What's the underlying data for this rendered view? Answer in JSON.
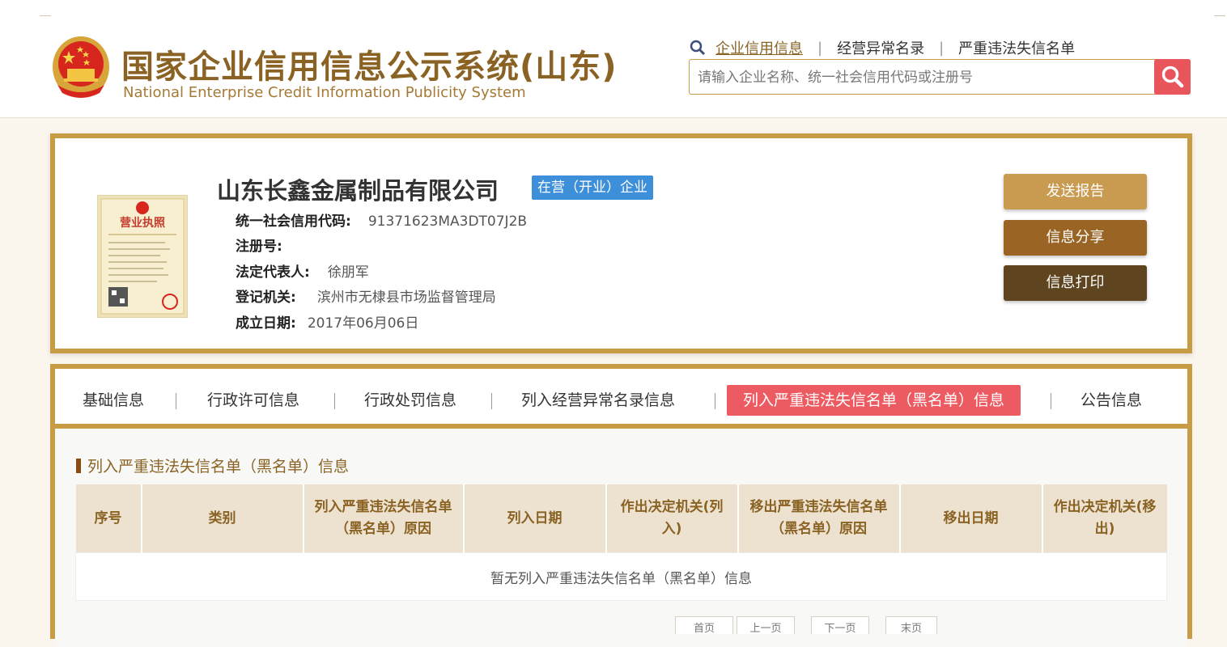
{
  "header": {
    "title": "国家企业信用信息公示系统(山东)",
    "subtitle": "National Enterprise Credit Information Publicity System",
    "nav": [
      {
        "label": "企业信用信息",
        "active": true
      },
      {
        "label": "经营异常名录",
        "active": false
      },
      {
        "label": "严重违法失信名单",
        "active": false
      }
    ],
    "search": {
      "placeholder": "请输入企业名称、统一社会信用代码或注册号",
      "value": ""
    }
  },
  "company": {
    "name": "山东长鑫金属制品有限公司",
    "status": "在营（开业）企业",
    "license_image_title": "营业执照",
    "fields": [
      {
        "label": "统一社会信用代码:",
        "value": "91371623MA3DT07J2B"
      },
      {
        "label": "注册号:",
        "value": ""
      },
      {
        "label": "法定代表人:",
        "value": "徐朋军"
      },
      {
        "label": "登记机关:",
        "value": "滨州市无棣县市场监督管理局"
      },
      {
        "label": "成立日期:",
        "value": "2017年06月06日"
      }
    ],
    "actions": [
      {
        "label": "发送报告",
        "color": "#c89b50"
      },
      {
        "label": "信息分享",
        "color": "#9a6524"
      },
      {
        "label": "信息打印",
        "color": "#5e4520"
      }
    ]
  },
  "tabs": [
    {
      "label": "基础信息",
      "active": false
    },
    {
      "label": "行政许可信息",
      "active": false
    },
    {
      "label": "行政处罚信息",
      "active": false
    },
    {
      "label": "列入经营异常名录信息",
      "active": false
    },
    {
      "label": "列入严重违法失信名单（黑名单）信息",
      "active": true
    },
    {
      "label": "公告信息",
      "active": false
    }
  ],
  "section": {
    "title": "列入严重违法失信名单（黑名单）信息",
    "columns": [
      "序号",
      "类别",
      "列入严重违法失信名单（黑名单）原因",
      "列入日期",
      "作出决定机关(列入)",
      "移出严重违法失信名单（黑名单）原因",
      "移出日期",
      "作出决定机关(移出)"
    ],
    "empty_message": "暂无列入严重违法失信名单（黑名单）信息"
  },
  "pagination": [
    "首页",
    "上一页",
    "下一页",
    "末页"
  ],
  "colors": {
    "gold": "#c89b45",
    "brown_text": "#8a6324",
    "badge_blue": "#3d8fda",
    "active_tab_red": "#ec5b61",
    "search_red": "#e8565c"
  }
}
